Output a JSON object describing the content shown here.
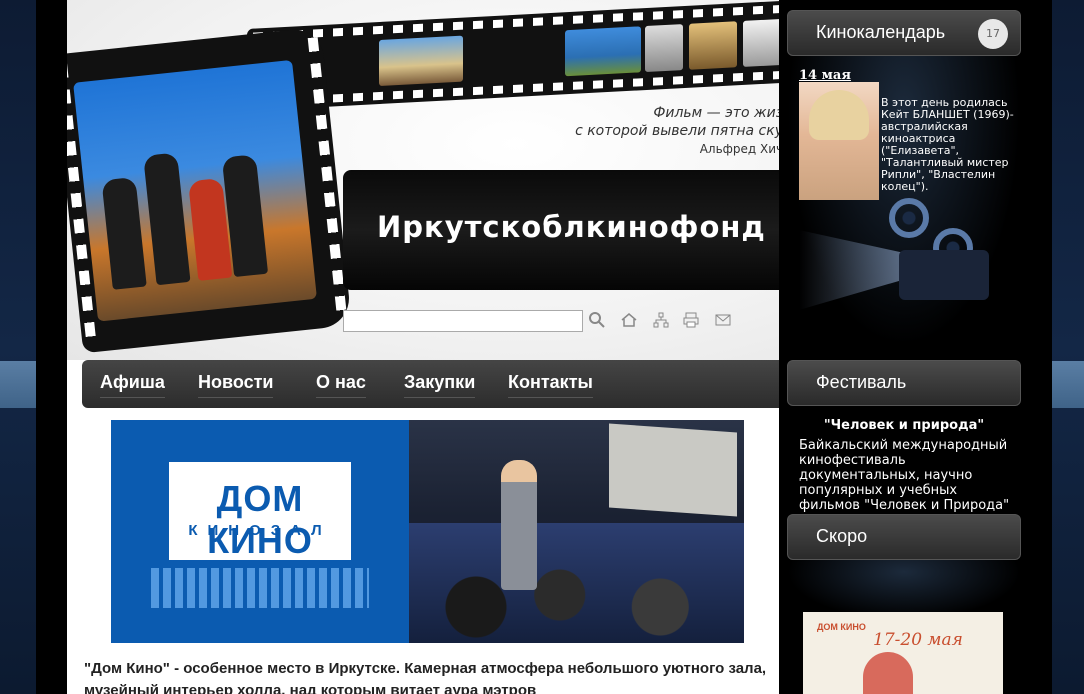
{
  "site": {
    "title": "Иркутскоблкинофонд"
  },
  "quote": {
    "line1": "Фильм — это жизнь,",
    "line2": "с которой вывели пятна скуки.",
    "author": "Альфред Хичкок"
  },
  "search": {
    "placeholder": "",
    "value": ""
  },
  "toolbar": {
    "icons": [
      "search-icon",
      "home-icon",
      "sitemap-icon",
      "print-icon",
      "mail-icon"
    ]
  },
  "nav": {
    "items": [
      {
        "label": "Афиша"
      },
      {
        "label": "Новости"
      },
      {
        "label": "О нас"
      },
      {
        "label": "Закупки"
      },
      {
        "label": "Контакты"
      }
    ]
  },
  "banner": {
    "logo_main": "ДОМ КИНО",
    "logo_sub": "КИНОЗАЛ"
  },
  "article": {
    "text": "\"Дом Кино\" - особенное место в Иркутске. Камерная атмосфера небольшого уютного зала, музейный интерьер холла, над которым витает аура мэтров"
  },
  "sidebar": {
    "calendar": {
      "heading": "Кинокалендарь",
      "icon_label": "17",
      "date": "14 мая",
      "text": "В этот день родилась Кейт БЛАНШЕТ (1969)- австралийская киноактриса (\"Елизавета\", \"Талантливый мистер Рипли\", \"Властелин колец\")."
    },
    "festival": {
      "heading": "Фестиваль",
      "title": "\"Человек и природа\"",
      "text": "Байкальский международный кинофестиваль документальных, научно популярных и учебных фильмов \"Человек и Природа\""
    },
    "soon": {
      "heading": "Скоро",
      "poster_title": "ДОМ КИНО",
      "poster_dates": "17-20 мая"
    }
  },
  "colors": {
    "background": "#0f1a2e",
    "nav": "#333333",
    "brand_blue": "#0b5bb0",
    "sidebar": "#000000"
  }
}
